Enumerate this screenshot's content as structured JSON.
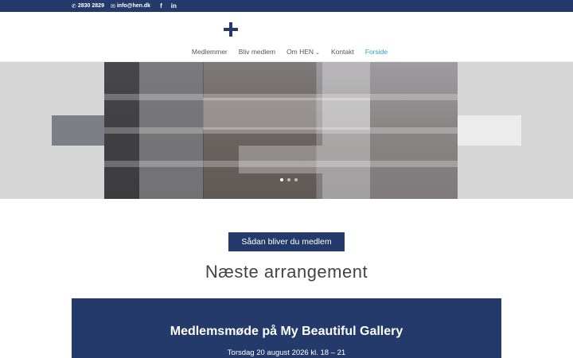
{
  "topbar": {
    "phone_icon": "phone-icon",
    "phone": "2830 2829",
    "email_icon": "envelope-icon",
    "email": "info@hen.dk",
    "facebook_icon": "facebook-icon",
    "facebook_glyph": "f",
    "linkedin_icon": "linkedin-icon",
    "linkedin_glyph": "in"
  },
  "header": {
    "logo": "plus-logo",
    "nav": [
      {
        "label": "Medlemmer"
      },
      {
        "label": "Bliv medlem"
      },
      {
        "label": "Om HEN",
        "dropdown": true
      },
      {
        "label": "Kontakt"
      },
      {
        "label": "Forside",
        "active": true
      }
    ]
  },
  "hero": {
    "slides_count": 3,
    "active_slide": 1
  },
  "cta": {
    "label": "Sådan bliver du medlem"
  },
  "section": {
    "title": "Næste arrangement"
  },
  "event": {
    "title": "Medlemsmøde på My Beautiful Gallery",
    "date": "Torsdag 20 august 2026 kl. 18 – 21"
  },
  "colors": {
    "brand_navy": "#243a6b",
    "active_link": "#2aa3c8"
  }
}
